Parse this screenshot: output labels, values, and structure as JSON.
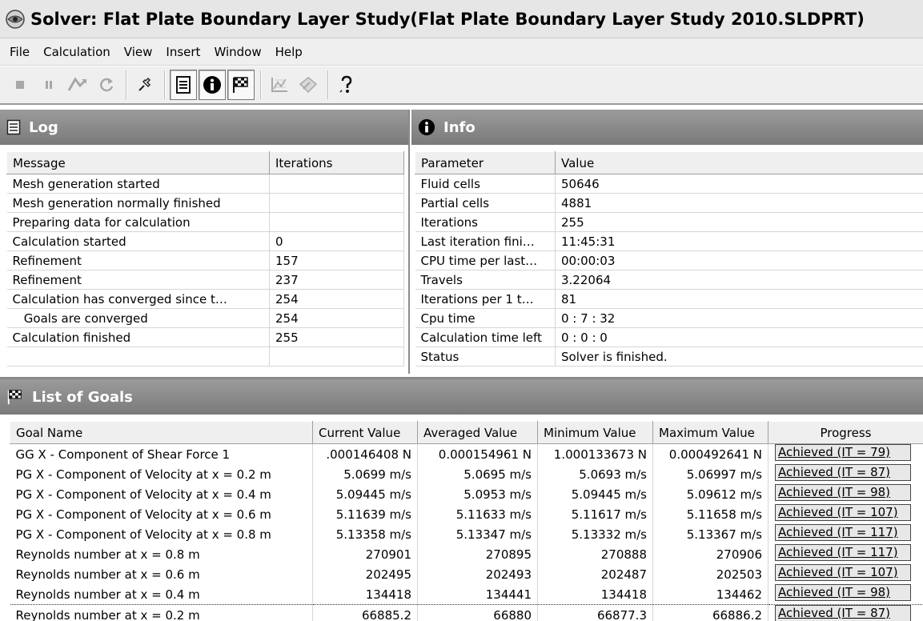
{
  "window": {
    "title": "Solver: Flat Plate Boundary Layer Study(Flat Plate Boundary Layer Study 2010.SLDPRT)"
  },
  "menu": [
    "File",
    "Calculation",
    "View",
    "Insert",
    "Window",
    "Help"
  ],
  "toolbar": {
    "icons": [
      "stop-icon",
      "pause-icon",
      "step-icon",
      "refresh-icon",
      "pin-icon",
      "log-view-icon",
      "info-view-icon",
      "goals-view-icon",
      "plot-view-icon",
      "preview-icon",
      "help-icon"
    ]
  },
  "log": {
    "title": "Log",
    "columns": [
      "Message",
      "Iterations"
    ],
    "rows": [
      [
        "Mesh generation started",
        ""
      ],
      [
        "Mesh generation normally finished",
        ""
      ],
      [
        "Preparing data for calculation",
        ""
      ],
      [
        "Calculation started",
        "0"
      ],
      [
        "Refinement",
        "157"
      ],
      [
        "Refinement",
        "237"
      ],
      [
        "Calculation has converged since t…",
        "254"
      ],
      [
        "   Goals are converged",
        "254"
      ],
      [
        "Calculation finished",
        "255"
      ],
      [
        "",
        ""
      ]
    ]
  },
  "info": {
    "title": "Info",
    "columns": [
      "Parameter",
      "Value"
    ],
    "rows": [
      [
        "Fluid cells",
        "50646"
      ],
      [
        "Partial cells",
        "4881"
      ],
      [
        "Iterations",
        "255"
      ],
      [
        "Last iteration fini…",
        "11:45:31"
      ],
      [
        "CPU time per last…",
        "00:00:03"
      ],
      [
        "Travels",
        "3.22064"
      ],
      [
        "Iterations per 1 t…",
        "81"
      ],
      [
        "Cpu time",
        "0 : 7 : 32"
      ],
      [
        "Calculation time left",
        "0 : 0 : 0"
      ],
      [
        "Status",
        "Solver is finished."
      ]
    ]
  },
  "goals": {
    "title": "List of Goals",
    "columns": [
      "Goal Name",
      "Current Value",
      "Averaged Value",
      "Minimum Value",
      "Maximum Value",
      "Progress"
    ],
    "rows": [
      [
        "GG X - Component of Shear Force 1",
        ".000146408 N",
        "0.000154961 N",
        "1.000133673 N",
        "0.000492641 N",
        "Achieved (IT = 79)"
      ],
      [
        "PG X - Component of Velocity at x = 0.2 m",
        "5.0699 m/s",
        "5.0695 m/s",
        "5.0693 m/s",
        "5.06997 m/s",
        "Achieved (IT = 87)"
      ],
      [
        "PG X - Component of Velocity at x = 0.4 m",
        "5.09445 m/s",
        "5.0953 m/s",
        "5.09445 m/s",
        "5.09612 m/s",
        "Achieved (IT = 98)"
      ],
      [
        "PG X - Component of Velocity at x = 0.6 m",
        "5.11639 m/s",
        "5.11633 m/s",
        "5.11617 m/s",
        "5.11658 m/s",
        "Achieved (IT = 107)"
      ],
      [
        "PG X - Component of Velocity at x = 0.8 m",
        "5.13358 m/s",
        "5.13347 m/s",
        "5.13332 m/s",
        "5.13367 m/s",
        "Achieved (IT = 117)"
      ],
      [
        "Reynolds number at x = 0.8 m",
        "270901",
        "270895",
        "270888",
        "270906",
        "Achieved (IT = 117)"
      ],
      [
        "Reynolds number at x = 0.6 m",
        "202495",
        "202493",
        "202487",
        "202503",
        "Achieved (IT = 107)"
      ],
      [
        "Reynolds number at x = 0.4 m",
        "134418",
        "134441",
        "134418",
        "134462",
        "Achieved (IT = 98)"
      ],
      [
        "Reynolds number at x = 0.2 m",
        "66885.2",
        "66880",
        "66877.3",
        "66886.2",
        "Achieved (IT = 87)"
      ]
    ],
    "selected_row": 8
  }
}
